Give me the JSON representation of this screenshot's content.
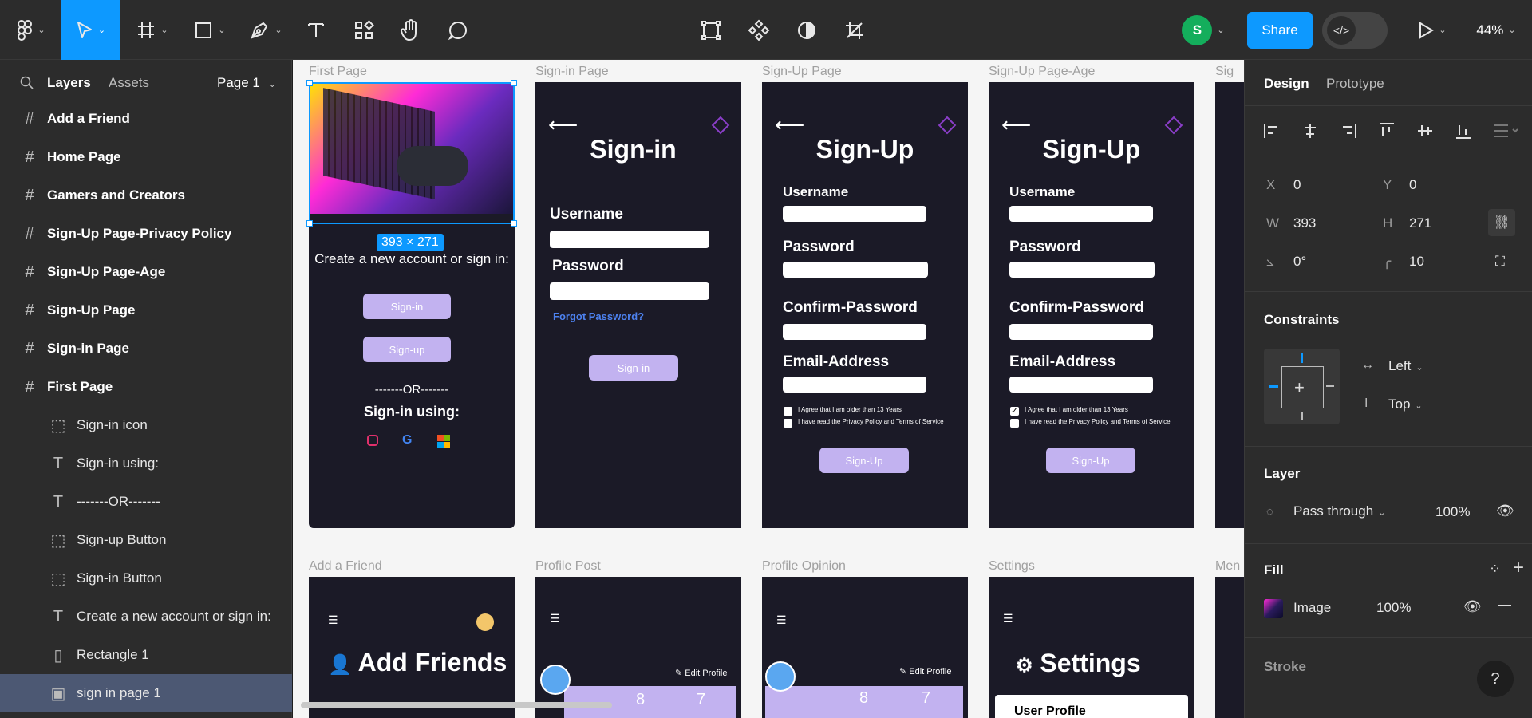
{
  "toolbar": {
    "avatar_letter": "S",
    "share_label": "Share",
    "dev_mode_icon": "</>",
    "zoom": "44%"
  },
  "left_panel": {
    "tabs": {
      "layers": "Layers",
      "assets": "Assets"
    },
    "page": "Page 1",
    "layers": [
      {
        "label": "Add a Friend",
        "icon": "frame-icon"
      },
      {
        "label": "Home Page",
        "icon": "frame-icon"
      },
      {
        "label": "Gamers and Creators",
        "icon": "frame-icon"
      },
      {
        "label": "Sign-Up Page-Privacy Policy",
        "icon": "frame-icon"
      },
      {
        "label": "Sign-Up Page-Age",
        "icon": "frame-icon"
      },
      {
        "label": "Sign-Up Page",
        "icon": "frame-icon"
      },
      {
        "label": "Sign-in Page",
        "icon": "frame-icon"
      },
      {
        "label": "First Page",
        "icon": "frame-icon"
      },
      {
        "label": "Sign-in icon",
        "icon": "group-icon"
      },
      {
        "label": "Sign-in using:",
        "icon": "text-icon"
      },
      {
        "label": "-------OR-------",
        "icon": "text-icon"
      },
      {
        "label": "Sign-up Button",
        "icon": "group-icon"
      },
      {
        "label": "Sign-in Button",
        "icon": "group-icon"
      },
      {
        "label": "Create a new account or sign in:",
        "icon": "text-icon"
      },
      {
        "label": "Rectangle 1",
        "icon": "rectangle-icon"
      },
      {
        "label": "sign in page 1",
        "icon": "image-icon"
      }
    ]
  },
  "canvas": {
    "frame_labels": {
      "first": "First Page",
      "signin": "Sign-in Page",
      "signup": "Sign-Up Page",
      "signup_age": "Sign-Up Page-Age",
      "cut": "Sig",
      "add_friend": "Add a Friend",
      "profile_post": "Profile Post",
      "profile_opinion": "Profile Opinion",
      "settings": "Settings",
      "menu_cut": "Men"
    },
    "selection_size": "393 × 271",
    "first_page": {
      "create_text": "Create a new account or sign in:",
      "signin_btn": "Sign-in",
      "signup_btn": "Sign-up",
      "or_text": "-------OR-------",
      "using_text": "Sign-in using:"
    },
    "signin_page": {
      "title": "Sign-in",
      "username": "Username",
      "password": "Password",
      "forgot": "Forgot Password?",
      "button": "Sign-in"
    },
    "signup_page": {
      "title": "Sign-Up",
      "username": "Username",
      "password": "Password",
      "confirm": "Confirm-Password",
      "email": "Email-Address",
      "agree": "I Agree that I am older than 13 Years",
      "privacy": "I have read the Privacy Policy and Terms of Service",
      "button": "Sign-Up"
    },
    "add_friend_page": {
      "title": "Add Friends"
    },
    "profile": {
      "edit": "Edit Profile",
      "stat_a": "8",
      "stat_b": "7"
    },
    "settings_page": {
      "title": "Settings",
      "item": "User Profile"
    }
  },
  "right_panel": {
    "tabs": {
      "design": "Design",
      "prototype": "Prototype"
    },
    "x_label": "X",
    "x_value": "0",
    "y_label": "Y",
    "y_value": "0",
    "w_label": "W",
    "w_value": "393",
    "h_label": "H",
    "h_value": "271",
    "rotation": "0°",
    "radius": "10",
    "constraints_title": "Constraints",
    "constraint_h": "Left",
    "constraint_v": "Top",
    "layer_title": "Layer",
    "blend": "Pass through",
    "opacity": "100%",
    "fill_title": "Fill",
    "fill_type": "Image",
    "fill_opacity": "100%",
    "stroke_title": "Stroke",
    "help": "?"
  },
  "colors": {
    "accent": "#0d99ff",
    "button_purple": "#c2b2f0",
    "frame_bg": "#1b1a27",
    "avatar_green": "#14ae5c"
  }
}
